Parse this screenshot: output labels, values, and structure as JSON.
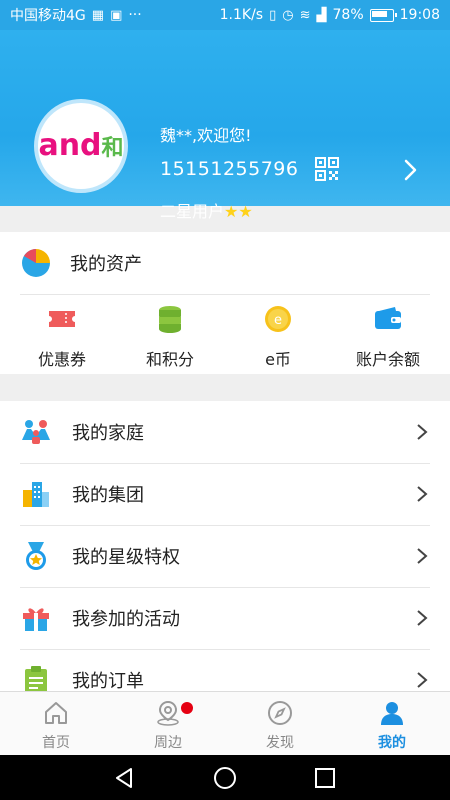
{
  "status_bar": {
    "carrier": "中国移动4G",
    "speed": "1.1K/s",
    "network": "4G",
    "battery": "78%",
    "time": "19:08",
    "more": "···"
  },
  "header": {
    "welcome": "魏**,欢迎您!",
    "phone": "15151255796",
    "level": "二星用户",
    "stars": "★★",
    "logo_text": "and",
    "logo_he": "和"
  },
  "assets": {
    "title": "我的资产",
    "items": [
      {
        "label": "优惠券",
        "icon": "ticket-icon"
      },
      {
        "label": "和积分",
        "icon": "coins-icon"
      },
      {
        "label": "e币",
        "icon": "ecoin-icon"
      },
      {
        "label": "账户余额",
        "icon": "wallet-icon"
      }
    ]
  },
  "menu": {
    "items": [
      {
        "label": "我的家庭",
        "icon": "family-icon"
      },
      {
        "label": "我的集团",
        "icon": "buildings-icon"
      },
      {
        "label": "我的星级特权",
        "icon": "medal-icon"
      },
      {
        "label": "我参加的活动",
        "icon": "gift-icon"
      },
      {
        "label": "我的订单",
        "icon": "clipboard-icon"
      }
    ]
  },
  "tabs": [
    {
      "label": "首页",
      "icon": "home-icon",
      "active": false
    },
    {
      "label": "周边",
      "icon": "location-icon",
      "active": false,
      "badge": true
    },
    {
      "label": "发现",
      "icon": "compass-icon",
      "active": false
    },
    {
      "label": "我的",
      "icon": "person-icon",
      "active": true
    }
  ],
  "colors": {
    "header_blue": "#2aa6e6",
    "active_tab": "#1c8fe0",
    "badge_red": "#e50012"
  }
}
